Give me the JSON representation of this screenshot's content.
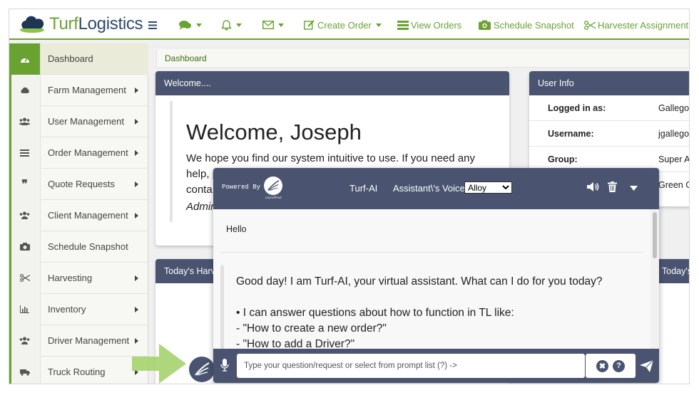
{
  "brand": {
    "name_part1": "Turf",
    "name_part2": "Logistics"
  },
  "topnav": {
    "create_order": "Create Order",
    "view_orders": "View Orders",
    "schedule_snapshot": "Schedule Snapshot",
    "harvester_assignment": "Harvester Assignment"
  },
  "sidebar": {
    "items": [
      {
        "label": "Dashboard",
        "icon": "dashboard-icon",
        "active": true
      },
      {
        "label": "Farm Management",
        "icon": "cloud-icon"
      },
      {
        "label": "User Management",
        "icon": "users-icon"
      },
      {
        "label": "Order Management",
        "icon": "list-icon"
      },
      {
        "label": "Quote Requests",
        "icon": "quote-icon"
      },
      {
        "label": "Client Management",
        "icon": "users-icon"
      },
      {
        "label": "Schedule Snapshot",
        "icon": "camera-icon"
      },
      {
        "label": "Harvesting",
        "icon": "scissors-icon"
      },
      {
        "label": "Inventory",
        "icon": "bar-chart-icon"
      },
      {
        "label": "Driver Management",
        "icon": "users-icon"
      },
      {
        "label": "Truck Routing",
        "icon": "truck-icon"
      }
    ]
  },
  "breadcrumb": "Dashboard",
  "welcome_panel": {
    "header": "Welcome....",
    "title": "Welcome, Joseph",
    "body_line1": "We hope you find our system intuitive to use. If you need any",
    "body_line2": "help, p",
    "body_line3": "conta",
    "signature": "Admir"
  },
  "user_info": {
    "header": "User Info",
    "rows": [
      {
        "key": "Logged in as:",
        "value": "Gallego,J"
      },
      {
        "key": "Username:",
        "value": "jgallegos"
      },
      {
        "key": "Group:",
        "value": "Super Ad"
      },
      {
        "key": "",
        "value": "Green G"
      }
    ]
  },
  "todays_harvest": {
    "header_left": "Today's Harv",
    "header_right": "Today's"
  },
  "chat": {
    "powered_by": "Powered By",
    "logo_caption": "LaunchPad",
    "title": "Turf-AI",
    "voice_label": "Assistant\\'s Voice:",
    "voice_selected": "Alloy",
    "messages": {
      "user": "Hello",
      "bot_greeting": "Good day! I am Turf-AI, your virtual assistant. What can I do for you today?",
      "bot_line1": "• I can answer questions about how to function in TL like:",
      "bot_line2": "- \"How to create a new order?\"",
      "bot_line3": "- \"How to add a Driver?\""
    },
    "input_placeholder": "Type your question/request or select from prompt list (?) ->",
    "clear_label": "✖",
    "help_label": "?"
  },
  "colors": {
    "brand_green": "#6aa232",
    "header_navy": "#4a5471"
  }
}
